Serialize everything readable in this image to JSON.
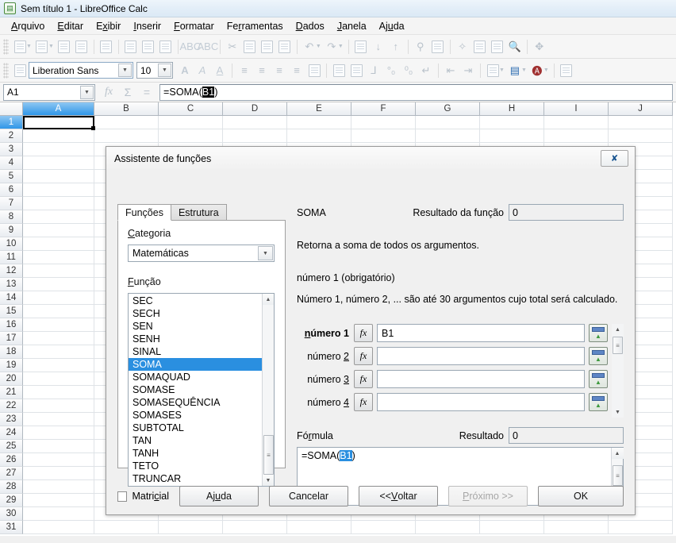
{
  "window": {
    "title": "Sem título 1 - LibreOffice Calc",
    "app_icon": "calc-document-icon",
    "minimize_label": "",
    "close_label": ""
  },
  "menubar": {
    "items": [
      {
        "label": "Arquivo",
        "accel": "A"
      },
      {
        "label": "Editar",
        "accel": "E"
      },
      {
        "label": "Exibir",
        "accel": "x"
      },
      {
        "label": "Inserir",
        "accel": "I"
      },
      {
        "label": "Formatar",
        "accel": "F"
      },
      {
        "label": "Ferramentas",
        "accel": "r"
      },
      {
        "label": "Dados",
        "accel": "D"
      },
      {
        "label": "Janela",
        "accel": "J"
      },
      {
        "label": "Ajuda",
        "accel": "u"
      }
    ]
  },
  "standard_toolbar": {
    "icons": [
      "new-document-icon",
      "open-document-icon",
      "save-icon",
      "email-icon",
      "edit-mode-icon",
      "export-pdf-icon",
      "print-icon",
      "print-preview-icon",
      "spelling-icon",
      "autospellcheck-icon",
      "cut-icon",
      "copy-icon",
      "paste-icon",
      "clone-formatting-icon",
      "undo-icon",
      "redo-icon",
      "find-replace-icon",
      "sort-ascending-icon",
      "sort-descending-icon",
      "autofilter-icon",
      "insert-image-icon",
      "insert-chart-icon",
      "insert-special-character-icon",
      "insert-hyperlink-icon",
      "headers-footers-icon",
      "zoom-icon",
      "help-icon"
    ]
  },
  "formatting_toolbar": {
    "style_icon": "paragraph-style-icon",
    "font_name": "Liberation Sans",
    "font_size": "10",
    "icons": [
      "bold-icon",
      "italic-icon",
      "underline-icon",
      "align-left-icon",
      "align-center-icon",
      "align-right-icon",
      "align-justified-icon",
      "merge-cells-icon",
      "format-as-currency-icon",
      "format-as-percent-icon",
      "format-as-number-icon",
      "add-decimal-icon",
      "delete-decimal-icon",
      "decrease-indent-icon",
      "increase-indent-icon",
      "borders-icon",
      "background-color-icon",
      "font-color-icon",
      "conditional-formatting-icon"
    ]
  },
  "formula_bar": {
    "name_box_value": "A1",
    "function_wizard_icon": "function-wizard-icon",
    "sum_icon": "sum-icon",
    "equals_icon": "equals-icon",
    "input_prefix": "=SOMA(",
    "input_selected": "B1",
    "input_suffix": ")"
  },
  "sheet": {
    "columns": [
      "A",
      "B",
      "C",
      "D",
      "E",
      "F",
      "G",
      "H",
      "I",
      "J"
    ],
    "active_column": "A",
    "rows": [
      "1",
      "2",
      "3",
      "4",
      "5",
      "6",
      "7",
      "8",
      "9",
      "10",
      "11",
      "12",
      "13",
      "14",
      "15",
      "16",
      "17",
      "18",
      "19",
      "20",
      "21",
      "22",
      "23",
      "24",
      "25",
      "26",
      "27",
      "28",
      "29",
      "30",
      "31"
    ],
    "active_row": "1",
    "active_cell": "A1"
  },
  "dialog": {
    "title": "Assistente de funções",
    "close_icon": "close-icon",
    "tabs": [
      {
        "label": "Funções",
        "active": true
      },
      {
        "label": "Estrutura",
        "active": false
      }
    ],
    "category_label": "Categoria",
    "category_label_accel": "C",
    "category_value": "Matemáticas",
    "function_label": "Função",
    "function_label_accel": "F",
    "functions": [
      "SEC",
      "SECH",
      "SEN",
      "SENH",
      "SINAL",
      "SOMA",
      "SOMAQUAD",
      "SOMASE",
      "SOMASEQUÊNCIA",
      "SOMASES",
      "SUBTOTAL",
      "TAN",
      "TANH",
      "TETO",
      "TRUNCAR"
    ],
    "selected_function": "SOMA",
    "function_name": "SOMA",
    "function_result_label": "Resultado da função",
    "function_result_value": "0",
    "description": "Retorna a soma de todos os argumentos.",
    "argument_title": "número 1 (obrigatório)",
    "argument_help": "Número 1, número 2, ... são até 30 argumentos cujo total será calculado.",
    "arguments": [
      {
        "label": "número 1",
        "accel": "n",
        "required": true,
        "value": "B1",
        "fx_icon": "fx-icon",
        "shrink_icon": "shrink-dialog-icon"
      },
      {
        "label": "número 2",
        "accel": "2",
        "required": false,
        "value": "",
        "fx_icon": "fx-icon",
        "shrink_icon": "shrink-dialog-icon"
      },
      {
        "label": "número 3",
        "accel": "3",
        "required": false,
        "value": "",
        "fx_icon": "fx-icon",
        "shrink_icon": "shrink-dialog-icon"
      },
      {
        "label": "número 4",
        "accel": "4",
        "required": false,
        "value": "",
        "fx_icon": "fx-icon",
        "shrink_icon": "shrink-dialog-icon"
      }
    ],
    "formula_label": "Fórmula",
    "formula_label_accel": "r",
    "result_label": "Resultado",
    "result_value": "0",
    "formula_prefix": "=SOMA(",
    "formula_selected": "B1",
    "formula_suffix": ")",
    "array_checkbox_label": "Matricial",
    "array_checkbox_accel": "c",
    "array_checked": false,
    "buttons": [
      {
        "label": "Ajuda",
        "accel": "u",
        "disabled": false,
        "name": "help-button"
      },
      {
        "label": "Cancelar",
        "accel": "",
        "disabled": false,
        "name": "cancel-button"
      },
      {
        "label": "<< Voltar",
        "accel": "V",
        "disabled": false,
        "name": "back-button"
      },
      {
        "label": "Próximo >>",
        "accel": "P",
        "disabled": true,
        "name": "next-button"
      },
      {
        "label": "OK",
        "accel": "",
        "disabled": false,
        "name": "ok-button"
      }
    ]
  },
  "colors": {
    "accent_blue": "#2a8fe0",
    "header_blue": "#2f96e8",
    "dialog_bg": "#f0f0f0",
    "selection_dark": "#000000"
  }
}
